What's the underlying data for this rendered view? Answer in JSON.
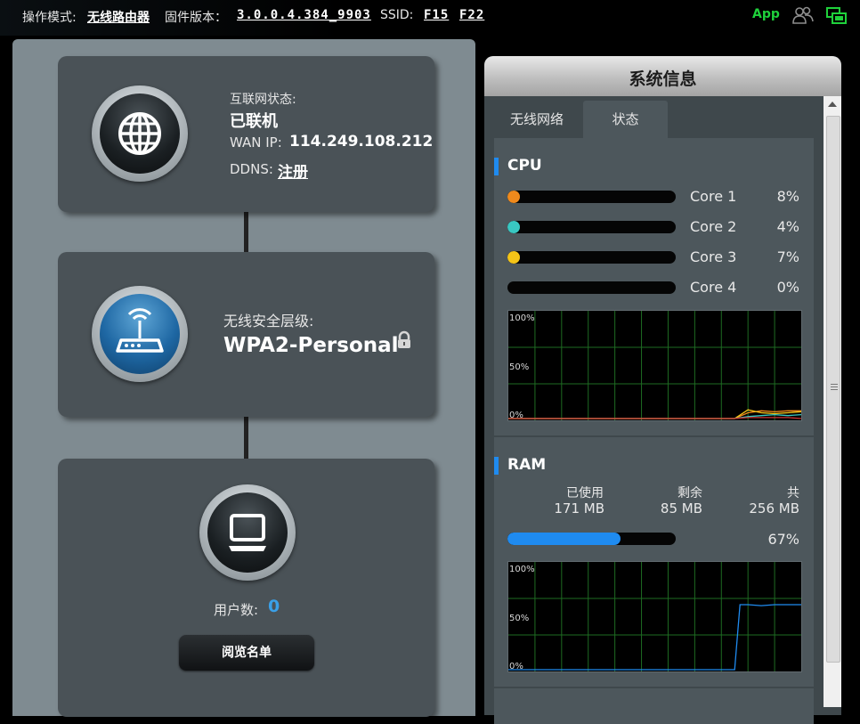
{
  "topbar": {
    "mode_label": "操作模式:",
    "mode_value": "无线路由器",
    "firmware_label": "固件版本：",
    "firmware_value": "3.0.0.4.384_9903",
    "ssid_label": "SSID:",
    "ssid_1": "F15",
    "ssid_2": "F22",
    "app_label": "App",
    "icons": [
      "users-icon",
      "network-monitor-icon"
    ],
    "accent_green": "#1fd13b"
  },
  "internet": {
    "status_label": "互联网状态:",
    "status_value": "已联机",
    "wan_ip_label": "WAN IP:",
    "wan_ip_value": "114.249.108.212",
    "ddns_label": "DDNS:",
    "ddns_value": "注册",
    "icon": "globe-icon"
  },
  "wireless": {
    "security_label": "无线安全层级:",
    "security_value": "WPA2-Personal",
    "icon": "router-icon",
    "lock_icon": "lock-icon"
  },
  "clients": {
    "count_label": "用户数:",
    "count_value": "0",
    "browse_button": "阅览名单",
    "icon": "monitor-icon",
    "count_color": "#3aa0e8"
  },
  "sysinfo": {
    "title": "系统信息",
    "tabs": [
      {
        "label": "无线网络",
        "active": false
      },
      {
        "label": "状态",
        "active": true
      }
    ],
    "cpu": {
      "title": "CPU",
      "cores": [
        {
          "label": "Core 1",
          "value": "8%",
          "percent": 8,
          "color": "#f08a1c"
        },
        {
          "label": "Core 2",
          "value": "4%",
          "percent": 4,
          "color": "#39c7c2"
        },
        {
          "label": "Core 3",
          "value": "7%",
          "percent": 7,
          "color": "#f5c518"
        },
        {
          "label": "Core 4",
          "value": "0%",
          "percent": 0,
          "color": "#cccccc"
        }
      ],
      "graph_labels": [
        "100%",
        "50%",
        "0%"
      ]
    },
    "ram": {
      "title": "RAM",
      "used_label": "已使用",
      "free_label": "剩余",
      "total_label": "共",
      "used_value": "171 MB",
      "free_value": "85 MB",
      "total_value": "256 MB",
      "usage_text": "67%",
      "usage_percent": 67,
      "bar_color": "#1f8bf0",
      "graph_labels": [
        "100%",
        "50%",
        "0%"
      ]
    }
  },
  "chart_data": [
    {
      "type": "line",
      "title": "",
      "ylim": [
        0,
        100
      ],
      "grid": true,
      "series": [
        {
          "color": "#f08a1c",
          "x": [
            0,
            17,
            18,
            19,
            20,
            21,
            22
          ],
          "values": [
            0,
            0,
            6,
            8,
            7,
            8,
            8
          ]
        },
        {
          "color": "#f5c518",
          "x": [
            0,
            17,
            18,
            19,
            20,
            21,
            22
          ],
          "values": [
            0,
            0,
            9,
            6,
            5,
            6,
            7
          ]
        },
        {
          "color": "#39c7c2",
          "x": [
            0,
            17,
            18,
            19,
            20,
            21,
            22
          ],
          "values": [
            0,
            0,
            2,
            3,
            4,
            3,
            4
          ]
        },
        {
          "color": "#cc3333",
          "x": [
            0,
            17,
            18,
            19,
            20,
            21,
            22
          ],
          "values": [
            0,
            0,
            1,
            1,
            1,
            1,
            0
          ]
        }
      ]
    },
    {
      "type": "line",
      "title": "",
      "ylim": [
        0,
        100
      ],
      "grid": true,
      "series": [
        {
          "color": "#1f8bf0",
          "x": [
            0,
            17,
            17.4,
            18,
            19,
            20,
            21,
            22
          ],
          "values": [
            0,
            0,
            67,
            67,
            66,
            67,
            67,
            67
          ]
        }
      ]
    }
  ]
}
